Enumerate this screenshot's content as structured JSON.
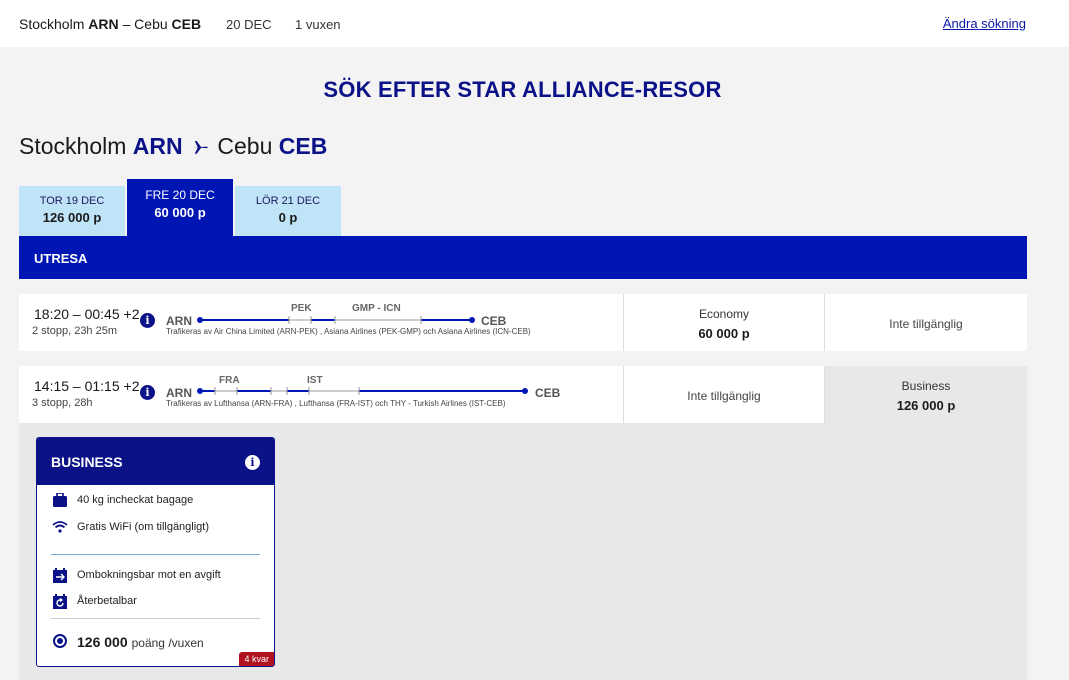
{
  "topbar": {
    "origin_city": "Stockholm",
    "origin_code": "ARN",
    "separator": "–",
    "dest_city": "Cebu",
    "dest_code": "CEB",
    "date": "20 DEC",
    "passengers": "1 vuxen",
    "change_search": "Ändra sökning"
  },
  "heading": "SÖK EFTER STAR ALLIANCE-RESOR",
  "route": {
    "origin_city": "Stockholm",
    "origin_code": "ARN",
    "dest_city": "Cebu",
    "dest_code": "CEB"
  },
  "date_tabs": [
    {
      "day": "TOR 19 DEC",
      "price": "126 000 p"
    },
    {
      "day": "FRE 20 DEC",
      "price": "60 000 p",
      "active": true
    },
    {
      "day": "LÖR 21 DEC",
      "price": "0 p"
    }
  ],
  "section_label": "UTRESA",
  "flights": [
    {
      "times": "18:20 – 00:45 +2",
      "stops": "2 stopp, 23h 25m",
      "from": "ARN",
      "to": "CEB",
      "via1": "PEK",
      "via2": "GMP - ICN",
      "operators": "Trafikeras av Air China Limited (ARN-PEK) , Asiana Airlines (PEK-GMP) och Asiana Airlines (ICN-CEB)",
      "economy_label": "Economy",
      "economy_price": "60 000 p",
      "business_text": "Inte tillgänglig"
    },
    {
      "times": "14:15 – 01:15 +2",
      "stops": "3 stopp, 28h",
      "from": "ARN",
      "to": "CEB",
      "via1": "FRA",
      "via2": "IST",
      "operators": "Trafikeras av Lufthansa (ARN-FRA) , Lufthansa (FRA-IST) och THY - Turkish Airlines (IST-CEB)",
      "economy_text": "Inte tillgänglig",
      "business_label": "Business",
      "business_price": "126 000 p"
    }
  ],
  "fare_card": {
    "title": "BUSINESS",
    "features": [
      "40 kg incheckat bagage",
      "Gratis WiFi (om tillgängligt)",
      "Ombokningsbar mot en avgift",
      "Återbetalbar"
    ],
    "price": "126 000",
    "unit": "poäng /vuxen",
    "seats_left": "4 kvar"
  },
  "colors": {
    "brand_blue": "#0016b4",
    "navy": "#0b1287",
    "tab_light": "#bfe3f7",
    "badge_red": "#b0121f"
  }
}
